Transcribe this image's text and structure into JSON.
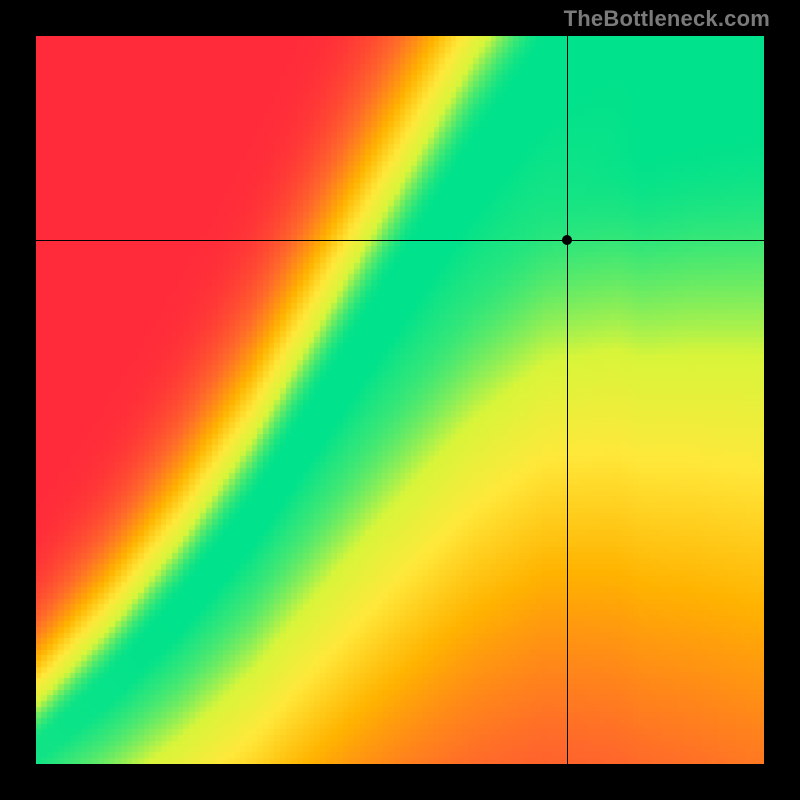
{
  "watermark": "TheBottleneck.com",
  "chart_data": {
    "type": "heatmap",
    "title": "",
    "xlabel": "",
    "ylabel": "",
    "xlim": [
      0,
      100
    ],
    "ylim": [
      0,
      100
    ],
    "grid": false,
    "legend": false,
    "pixelation": 128,
    "crosshair": {
      "x": 73,
      "y": 72
    },
    "marker": {
      "x": 73,
      "y": 72
    },
    "color_scale": [
      {
        "score": 0.0,
        "color": "#ff2a3a"
      },
      {
        "score": 0.25,
        "color": "#ff6a2a"
      },
      {
        "score": 0.5,
        "color": "#ffb300"
      },
      {
        "score": 0.7,
        "color": "#ffe83a"
      },
      {
        "score": 0.85,
        "color": "#d8f53a"
      },
      {
        "score": 1.0,
        "color": "#00e28c"
      }
    ],
    "ridge": {
      "description": "Normalized ideal y (0..1) for each normalized x (0..1). Score falls off with distance from this ridge along y.",
      "points": [
        {
          "x": 0.0,
          "y": 0.0
        },
        {
          "x": 0.1,
          "y": 0.08
        },
        {
          "x": 0.2,
          "y": 0.18
        },
        {
          "x": 0.3,
          "y": 0.3
        },
        {
          "x": 0.4,
          "y": 0.45
        },
        {
          "x": 0.5,
          "y": 0.6
        },
        {
          "x": 0.6,
          "y": 0.75
        },
        {
          "x": 0.7,
          "y": 0.88
        },
        {
          "x": 0.8,
          "y": 0.96
        },
        {
          "x": 0.9,
          "y": 1.0
        },
        {
          "x": 1.0,
          "y": 1.03
        }
      ],
      "band_half_width_base": 0.025,
      "band_growth": 0.12
    }
  }
}
